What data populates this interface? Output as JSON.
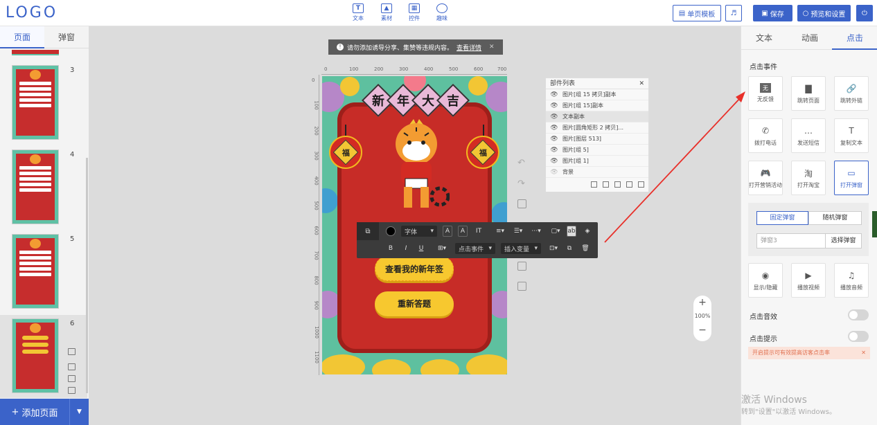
{
  "header": {
    "logo": "LOGO",
    "tools": [
      {
        "label": "文本",
        "icon": "text-icon",
        "glyph": "T"
      },
      {
        "label": "素材",
        "icon": "image-icon",
        "glyph": "▲"
      },
      {
        "label": "控件",
        "icon": "widget-icon",
        "glyph": "▦"
      },
      {
        "label": "趣味",
        "icon": "bulb-icon",
        "glyph": "◯"
      }
    ],
    "single_template": "单页模板",
    "music_glyph": "♬",
    "save": "保存",
    "preview": "预览和设置",
    "power_glyph": "⏻"
  },
  "left": {
    "tabs": [
      "页面",
      "弹窗"
    ],
    "pages": [
      {
        "num": "3"
      },
      {
        "num": "4"
      },
      {
        "num": "5"
      },
      {
        "num": "6"
      }
    ],
    "add_page": "添加页面",
    "add_glyph": "+",
    "drop_glyph": "▼"
  },
  "notice": {
    "icon_glyph": "❗",
    "text": "请勿添加诱导分享、集赞等违规内容。",
    "link": "查看详情",
    "close": "✕"
  },
  "ruler": {
    "top": [
      "0",
      "100",
      "200",
      "300",
      "400",
      "500",
      "600",
      "700"
    ],
    "left": [
      "0",
      "100",
      "200",
      "300",
      "400",
      "500",
      "600",
      "700",
      "800",
      "900",
      "1000",
      "1100"
    ]
  },
  "canvas": {
    "title_chars": [
      "新",
      "年",
      "大",
      "吉"
    ],
    "lantern_char": "福",
    "btn_main": "查看我的新年签",
    "btn_second": "重新答题",
    "colors": {
      "red": "#c72c27",
      "gold": "#f7c82f",
      "teal": "#5ec09f"
    }
  },
  "toolbar": {
    "font": "字体",
    "click_event": "点击事件",
    "insert_var": "插入变量"
  },
  "layers": {
    "title": "部件列表",
    "close": "✕",
    "rows": [
      {
        "label": "图片[组 15 拷贝]副本",
        "eye": "👁"
      },
      {
        "label": "图片[组 15]副本",
        "eye": "👁"
      },
      {
        "label": "文本副本",
        "eye": "👁",
        "active": true
      },
      {
        "label": "图片[圆角矩形 2 拷贝]...",
        "eye": "👁"
      },
      {
        "label": "图片[图层 513]",
        "eye": "👁"
      },
      {
        "label": "图片[组 5]",
        "eye": "👁"
      },
      {
        "label": "图片[组 1]",
        "eye": "👁"
      },
      {
        "label": "背景",
        "eye": "👁"
      }
    ]
  },
  "zoom": {
    "plus": "+",
    "value": "100%",
    "minus": "−"
  },
  "right": {
    "tabs": [
      "文本",
      "动画",
      "点击"
    ],
    "click_event_title": "点击事件",
    "actions": [
      {
        "label": "无反馈",
        "icon": "no-feedback-icon",
        "glyph": "无"
      },
      {
        "label": "跳转页面",
        "icon": "page-icon",
        "glyph": "▇"
      },
      {
        "label": "跳转外链",
        "icon": "link-icon",
        "glyph": "🔗"
      },
      {
        "label": "拨打电话",
        "icon": "phone-icon",
        "glyph": "✆"
      },
      {
        "label": "发送短信",
        "icon": "sms-icon",
        "glyph": "…"
      },
      {
        "label": "复制文本",
        "icon": "copy-text-icon",
        "glyph": "T"
      },
      {
        "label": "打开营销活动",
        "icon": "gamepad-icon",
        "glyph": "🎮"
      },
      {
        "label": "打开淘宝",
        "icon": "taobao-icon",
        "glyph": "淘"
      },
      {
        "label": "打开弹窗",
        "icon": "popup-icon",
        "glyph": "▭",
        "active": true
      }
    ],
    "popup_tabs": [
      "固定弹窗",
      "随机弹窗"
    ],
    "popup_field": "弹窗3",
    "popup_select": "选择弹窗",
    "media_actions": [
      {
        "label": "显示/隐藏",
        "icon": "eye-icon",
        "glyph": "◉"
      },
      {
        "label": "播放视频",
        "icon": "play-icon",
        "glyph": "▶"
      },
      {
        "label": "播放音频",
        "icon": "music-icon",
        "glyph": "♫"
      }
    ],
    "click_sound": "点击音效",
    "click_tip": "点击提示",
    "tip_banner": "开启提示可有效提高访客点击率",
    "tip_close": "✕"
  },
  "watermark": {
    "line1": "激活 Windows",
    "line2": "转到\"设置\"以激活 Windows。"
  }
}
